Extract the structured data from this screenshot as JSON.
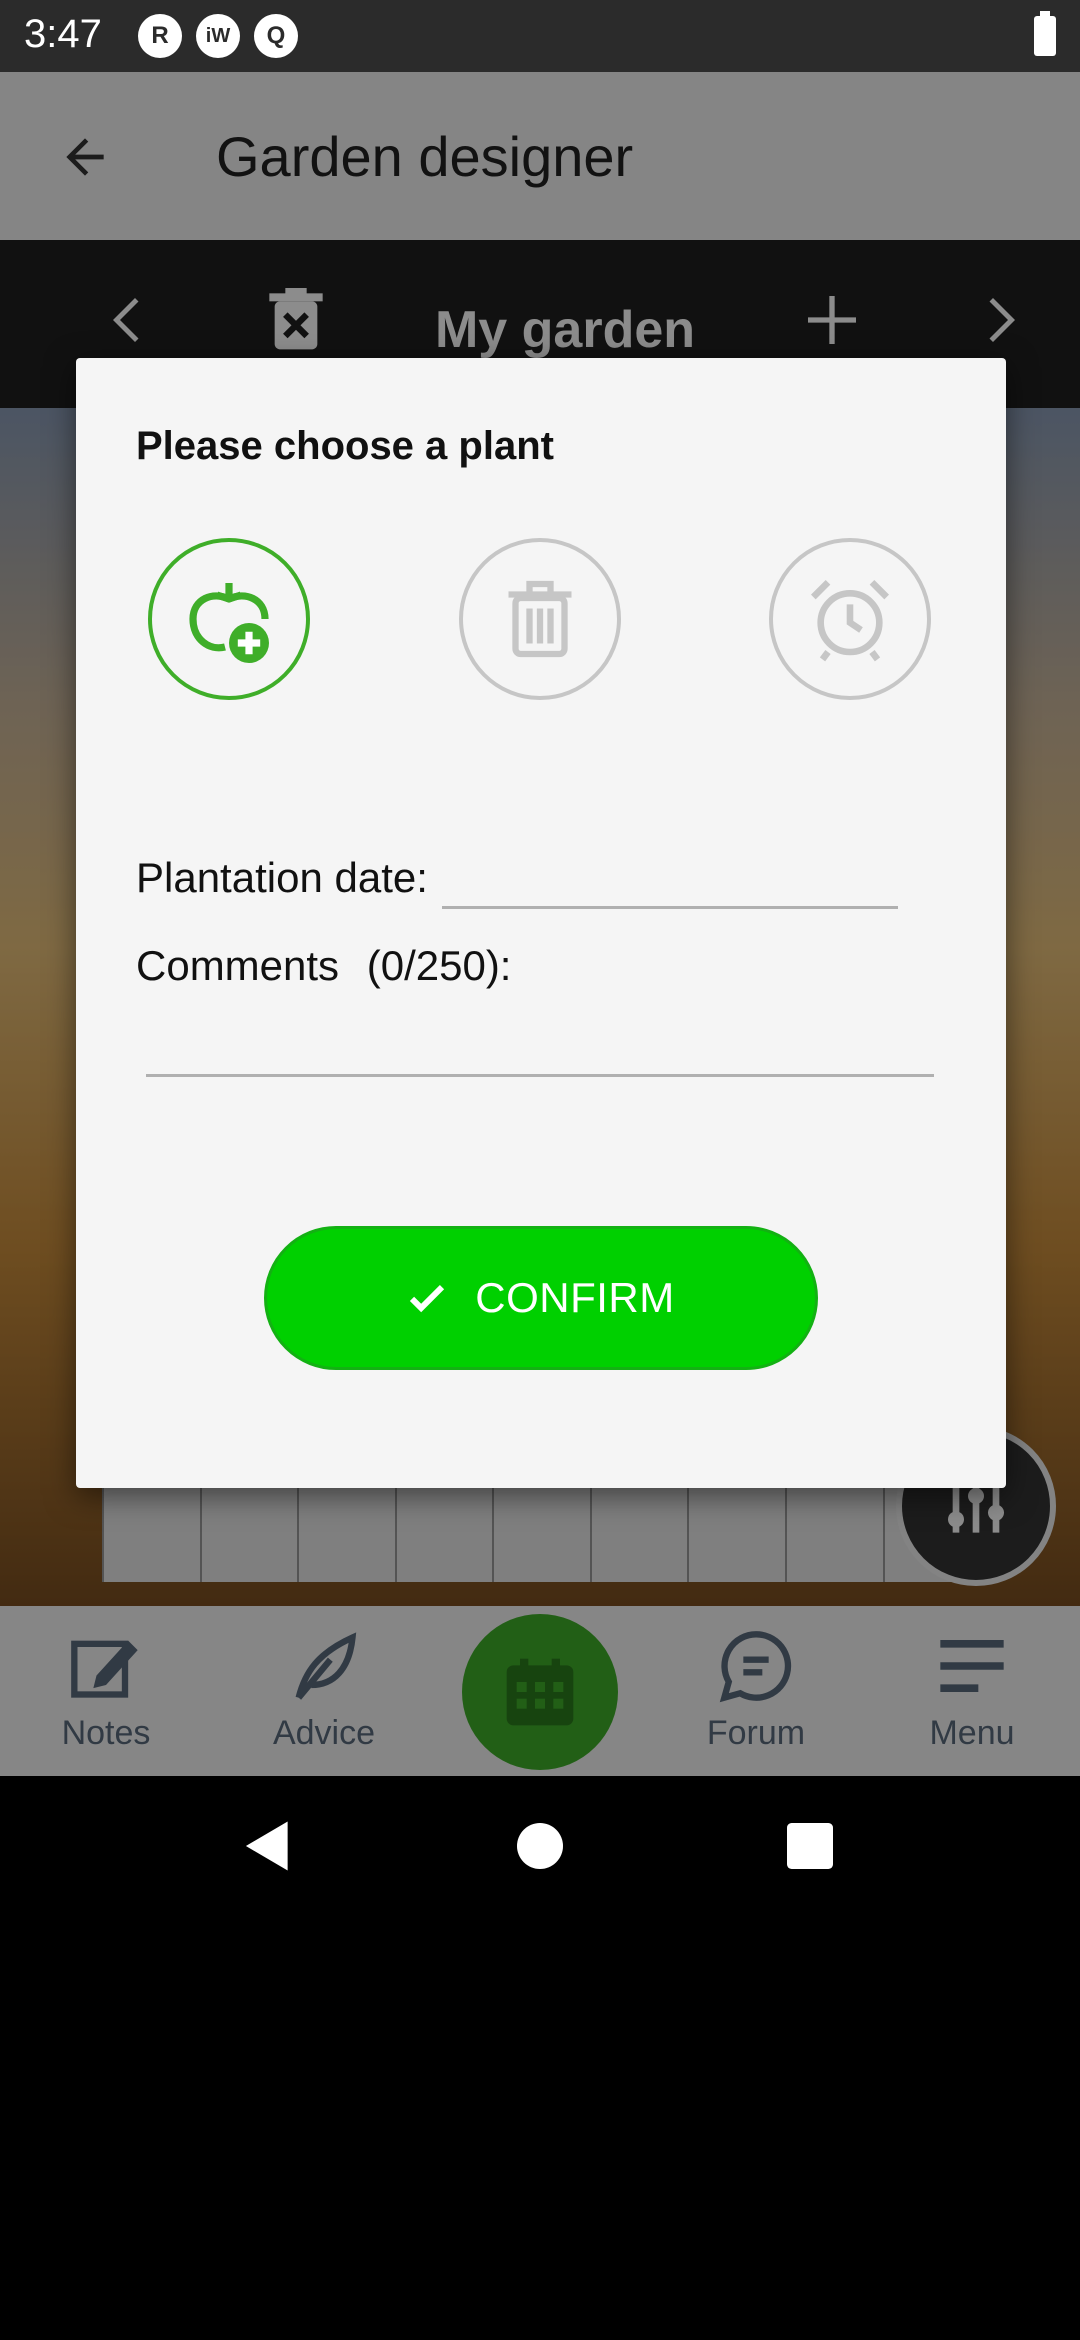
{
  "status_bar": {
    "time": "3:47",
    "icons": [
      {
        "name": "r-notification-icon",
        "glyph": "R"
      },
      {
        "name": "iw-notification-icon",
        "glyph": "iW"
      },
      {
        "name": "q-notification-icon",
        "glyph": "Q"
      }
    ]
  },
  "app_bar": {
    "title": "Garden designer"
  },
  "garden_toolbar": {
    "garden_name": "My garden"
  },
  "dialog": {
    "title": "Please choose a plant",
    "plantation_label": "Plantation date:",
    "plantation_value": "",
    "comments_label": "Comments",
    "comments_count": "(0/250):",
    "comments_value": "",
    "confirm_label": "CONFIRM"
  },
  "bottom_nav": {
    "items": [
      {
        "label": "Notes",
        "icon": "notes-icon"
      },
      {
        "label": "Advice",
        "icon": "leaf-icon"
      },
      {
        "label": "",
        "icon": "calendar-icon"
      },
      {
        "label": "Forum",
        "icon": "chat-icon"
      },
      {
        "label": "Menu",
        "icon": "menu-icon"
      }
    ]
  },
  "colors": {
    "accent_green": "#3fae29",
    "confirm_green": "#00d000",
    "inactive_grey": "#c6c6c6"
  }
}
